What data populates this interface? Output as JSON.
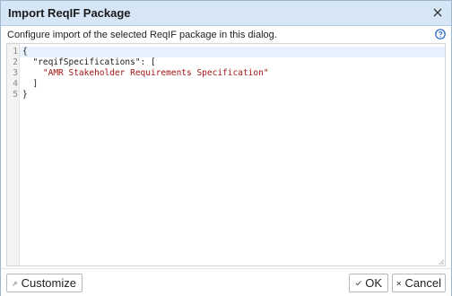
{
  "dialog": {
    "title": "Import ReqIF Package",
    "description": "Configure import of the selected ReqIF package in this dialog."
  },
  "editor": {
    "line_numbers": [
      "1",
      "2",
      "3",
      "4",
      "5"
    ],
    "lines": {
      "l1": "{",
      "l2_key": "  \"reqifSpecifications\": [",
      "l3_str": "    \"AMR Stakeholder Requirements Specification\"",
      "l4": "  ]",
      "l5": "}"
    }
  },
  "footer": {
    "customize_label": "Customize",
    "ok_label": "OK",
    "cancel_label": "Cancel"
  },
  "icons": {
    "close": "close-icon",
    "help": "help-icon",
    "customize": "wrench-icon",
    "ok": "check-icon",
    "cancel": "x-icon"
  },
  "colors": {
    "titlebar": "#d7e6f6",
    "string": "#a31515",
    "help_blue": "#2563c9"
  }
}
